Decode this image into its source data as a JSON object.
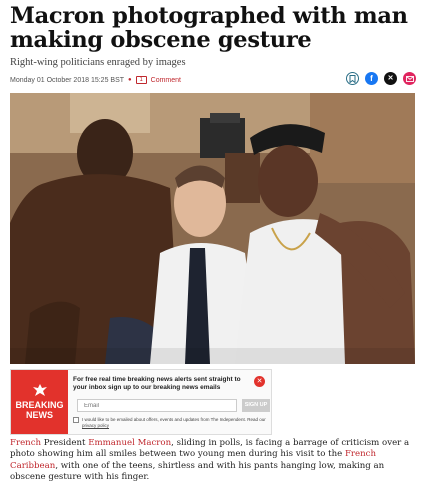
{
  "article": {
    "headline_line1": "Macron photographed with man",
    "headline_line2": "making obscene gesture",
    "subheadline": "Right-wing politicians enraged by images",
    "date": "Monday 01 October 2018 15:25 BST",
    "comment_count": "1",
    "comment_label": "Comment"
  },
  "share": {
    "icons": [
      "bookmark-icon",
      "facebook-icon",
      "twitter-x-icon",
      "email-icon"
    ]
  },
  "photo": {
    "description_icon": "article-photo"
  },
  "newsletter": {
    "brand_line1": "BREAKING",
    "brand_line2": "NEWS",
    "promo": "For free real time breaking news alerts sent straight to your inbox sign up to our breaking news emails",
    "email_placeholder": "Email",
    "signup_label": "SIGN UP",
    "consent_text": "I would like to be emailed about offers, events and updates from The Independent. Read our",
    "privacy_link": "privacy policy",
    "brand_color": "#e2322c"
  },
  "body": {
    "link_french": "French",
    "t1": " President ",
    "link_macron": "Emmanuel Macron",
    "t2": ", sliding in polls, is facing a barrage of criticism over a photo showing him all smiles between two young men during his visit to the ",
    "link_caribbean": "French Caribbean",
    "t3": ", with one of the teens, shirtless and with his pants hanging low, making an obscene gesture with his finger."
  },
  "colors": {
    "accent": "#c0282e",
    "facebook": "#1877f2"
  }
}
